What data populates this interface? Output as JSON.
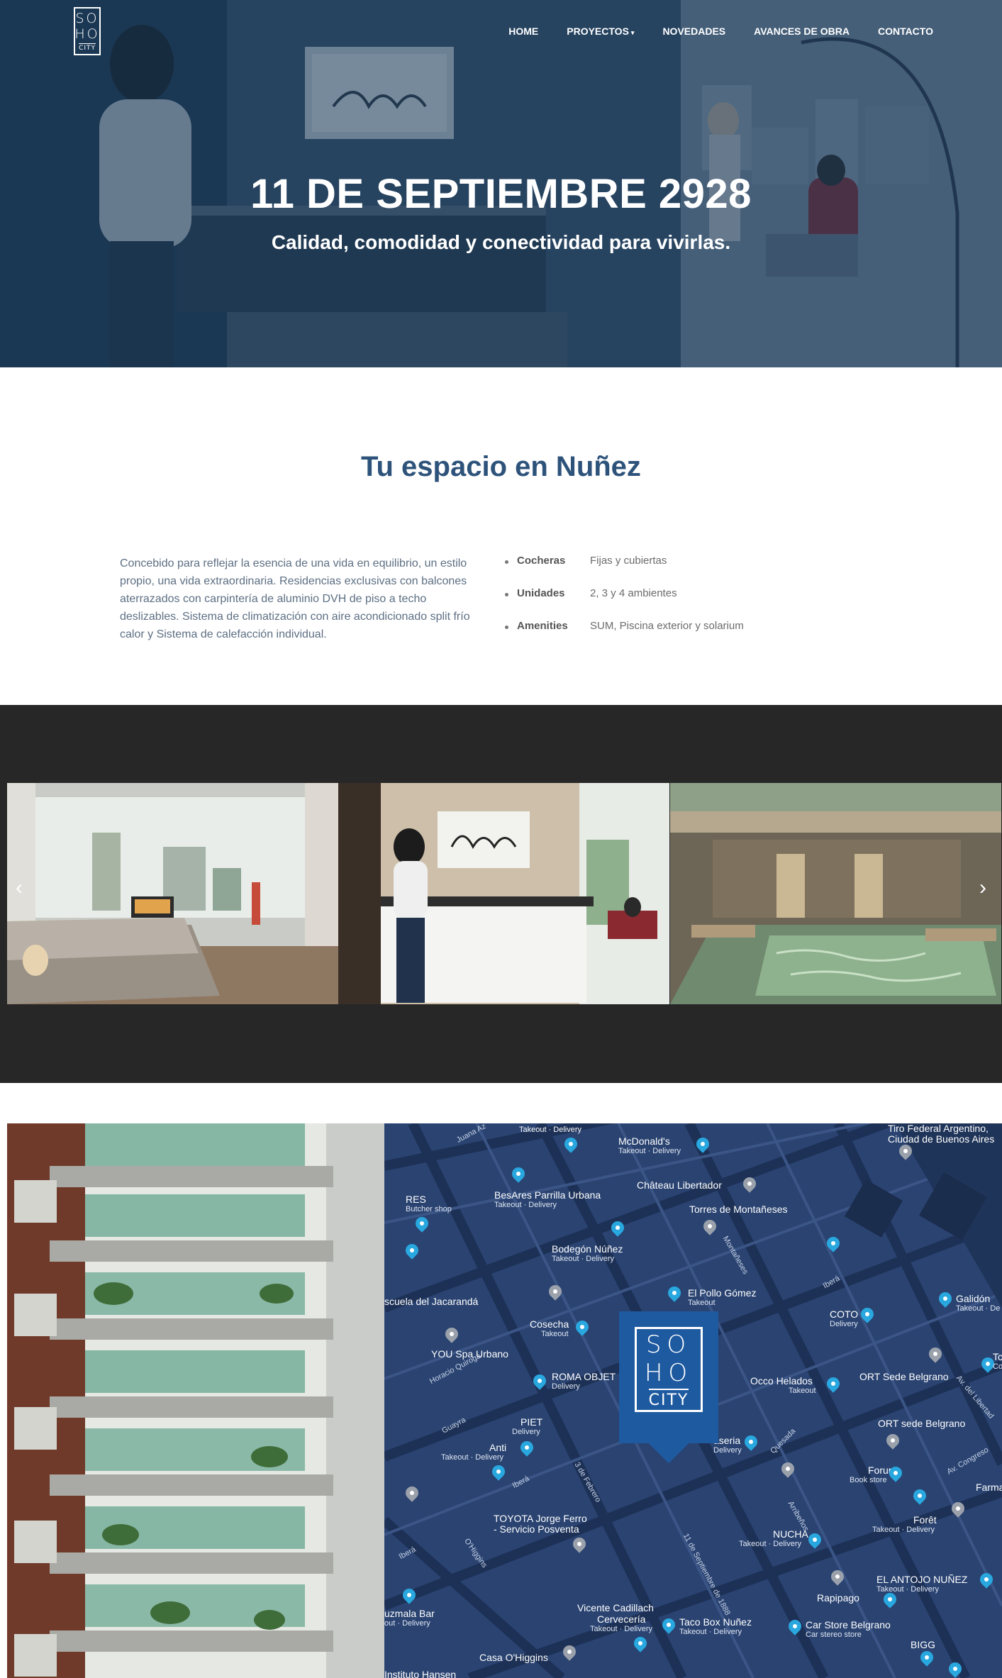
{
  "logo": {
    "line1": "SO",
    "line2": "HO",
    "line3": "CITY"
  },
  "nav": [
    {
      "label": "HOME"
    },
    {
      "label": "PROYECTOS"
    },
    {
      "label": "NOVEDADES"
    },
    {
      "label": "AVANCES DE OBRA"
    },
    {
      "label": "CONTACTO"
    }
  ],
  "hero": {
    "title": "11 DE SEPTIEMBRE 2928",
    "subtitle": "Calidad, comodidad y conectividad para vivirlas."
  },
  "about": {
    "title": "Tu espacio en Nuñez",
    "text": "Concebido para reflejar la esencia de una vida en equilibrio, un estilo propio, una vida extraordinaria. Residencias exclusivas con balcones aterrazados con carpintería de aluminio DVH de piso a techo deslizables. Sistema de climatización con aire acondicionado split frío calor y Sistema de calefacción individual.",
    "features": [
      {
        "key": "Cocheras",
        "value": "Fijas y cubiertas"
      },
      {
        "key": "Unidades",
        "value": "2, 3 y 4 ambientes"
      },
      {
        "key": "Amenities",
        "value": "SUM, Piscina exterior y solarium"
      }
    ]
  },
  "gallery": {
    "prev_icon": "chevron-left-icon",
    "next_icon": "chevron-right-icon",
    "prev_glyph": "‹",
    "next_glyph": "›"
  },
  "map": {
    "logo": {
      "line1": "SO",
      "line2": "HO",
      "line3": "CITY"
    },
    "places": [
      {
        "name": "Takeout · Delivery",
        "sub": ""
      },
      {
        "name": "McDonald's",
        "sub": "Takeout · Delivery"
      },
      {
        "name": "Tiro Federal Argentino,",
        "sub": "Ciudad de Buenos Aires"
      },
      {
        "name": "RES",
        "sub": "Butcher shop"
      },
      {
        "name": "BesAres Parrilla Urbana",
        "sub": "Takeout · Delivery"
      },
      {
        "name": "Château Libertador",
        "sub": ""
      },
      {
        "name": "Torres de Montañeses",
        "sub": ""
      },
      {
        "name": "Bodegón Núñez",
        "sub": "Takeout · Delivery"
      },
      {
        "name": "scuela del Jacarandá",
        "sub": ""
      },
      {
        "name": "El Pollo Gómez",
        "sub": "Takeout"
      },
      {
        "name": "Galidón",
        "sub": "Takeout · De"
      },
      {
        "name": "Cosecha",
        "sub": "Takeout"
      },
      {
        "name": "COTO",
        "sub": "Delivery"
      },
      {
        "name": "YOU Spa Urbano",
        "sub": ""
      },
      {
        "name": "ROMA OBJET",
        "sub": "Delivery"
      },
      {
        "name": "Occo Helados",
        "sub": "Takeout"
      },
      {
        "name": "ORT Sede Belgrano",
        "sub": ""
      },
      {
        "name": "PIET",
        "sub": "Delivery"
      },
      {
        "name": "Anti",
        "sub": "Takeout · Delivery"
      },
      {
        "name": "aseria",
        "sub": "Delivery"
      },
      {
        "name": "ORT sede Belgrano",
        "sub": ""
      },
      {
        "name": "Forum",
        "sub": "Book store"
      },
      {
        "name": "Farma",
        "sub": ""
      },
      {
        "name": "Forêt",
        "sub": "Takeout · Delivery"
      },
      {
        "name": "TOYOTA Jorge Ferro",
        "sub": "- Servicio Posventa"
      },
      {
        "name": "NUCHA",
        "sub": "Takeout · Delivery"
      },
      {
        "name": "EL ANTOJO NUÑEZ",
        "sub": "Takeout · Delivery"
      },
      {
        "name": "Rapipago",
        "sub": ""
      },
      {
        "name": "uzmala Bar",
        "sub": "out · Delivery"
      },
      {
        "name": "Vicente Cadillach",
        "sub": ""
      },
      {
        "name": "Cervecería",
        "sub": "Takeout · Delivery"
      },
      {
        "name": "Taco Box Nuñez",
        "sub": "Takeout · Delivery"
      },
      {
        "name": "Car Store Belgrano",
        "sub": "Car stereo store"
      },
      {
        "name": "BIGG",
        "sub": ""
      },
      {
        "name": "Casa O'Higgins",
        "sub": ""
      },
      {
        "name": "Instituto Hansen",
        "sub": ""
      },
      {
        "name": "Tc",
        "sub": "Co"
      }
    ],
    "streets": [
      "Juana Az",
      "Montañeses",
      "Iberá",
      "Horacio Quiroga",
      "Guayra",
      "3 de Febrero",
      "Quesada",
      "Arribeños",
      "Av. Congreso",
      "Av. del Libertad",
      "11 de Septiembre de 1888",
      "O'Higgins",
      "Iberá",
      "Iberá"
    ]
  }
}
